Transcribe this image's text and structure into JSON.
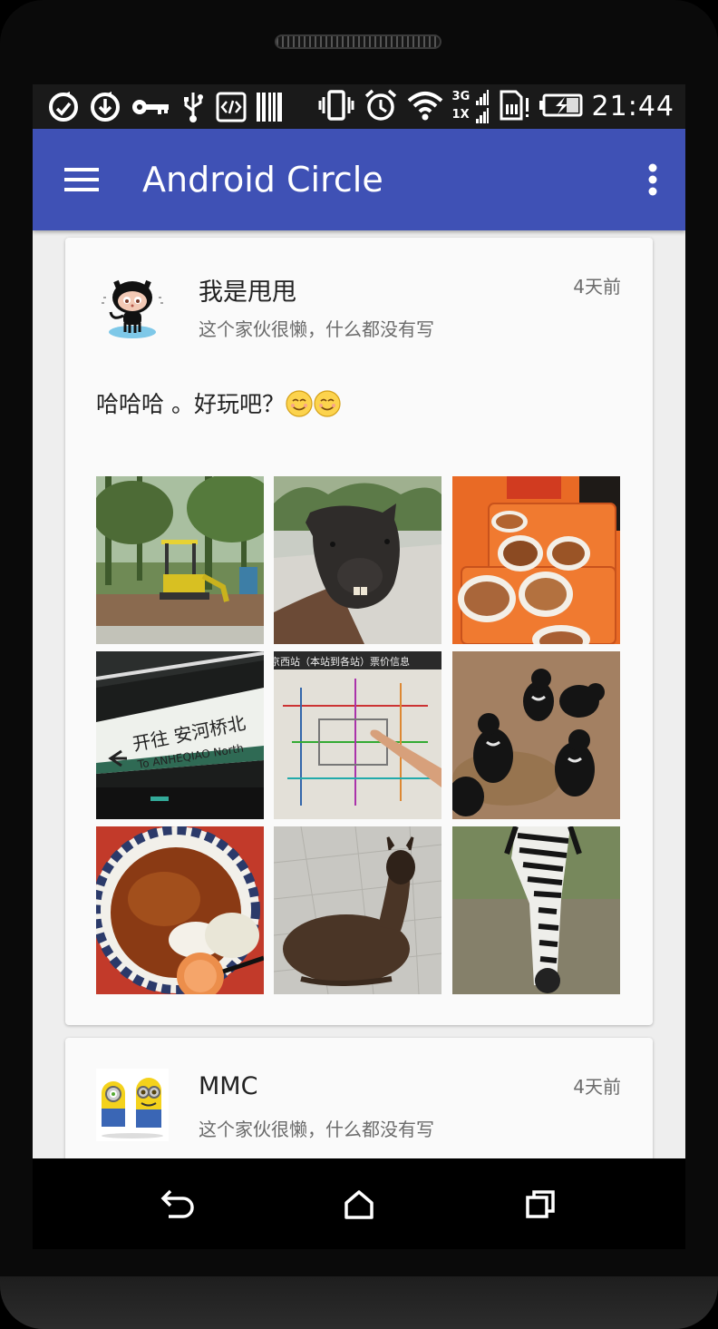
{
  "status_bar": {
    "time": "21:44",
    "network_label_top": "3G",
    "network_label_bottom": "1X",
    "icons": [
      "sync-icon",
      "sync-download-icon",
      "key-icon",
      "usb-icon",
      "code-icon",
      "barcode-icon",
      "vibrate-icon",
      "alarm-icon",
      "wifi-icon",
      "signal-icon",
      "sim-alert-icon",
      "battery-charging-icon"
    ]
  },
  "toolbar": {
    "title": "Android Circle",
    "menu_icon": "hamburger-menu-icon",
    "overflow_icon": "more-vert-icon"
  },
  "posts": [
    {
      "nickname": "我是甩甩",
      "signature": "这个家伙很懒，什么都没有写",
      "time_ago": "4天前",
      "avatar": "octocat-avatar",
      "content": "哈哈哈 。好玩吧？",
      "emojis": [
        "smiling-face-emoji",
        "smiling-face-emoji"
      ],
      "photos": [
        "excavator-ride-photo",
        "llama-closeup-photo",
        "food-trays-photo",
        "subway-sign-photo",
        "subway-map-photo",
        "black-bears-photo",
        "rice-bowl-photo",
        "alpaca-lying-photo",
        "zebra-grazing-photo"
      ],
      "subway_sign_text_cn": "开往 安河桥北",
      "subway_sign_text_en": "To ANHEQIAO North",
      "subway_map_caption": "京西站（本站到各站）票价信息"
    },
    {
      "nickname": "MMC",
      "signature": "这个家伙很懒，什么都没有写",
      "time_ago": "4天前",
      "avatar": "minions-avatar"
    }
  ],
  "nav_bar": {
    "back_icon": "back-icon",
    "home_icon": "home-icon",
    "recents_icon": "recents-icon"
  },
  "colors": {
    "primary": "#3f51b5",
    "background": "#eeeeee",
    "card": "#fafafa"
  }
}
